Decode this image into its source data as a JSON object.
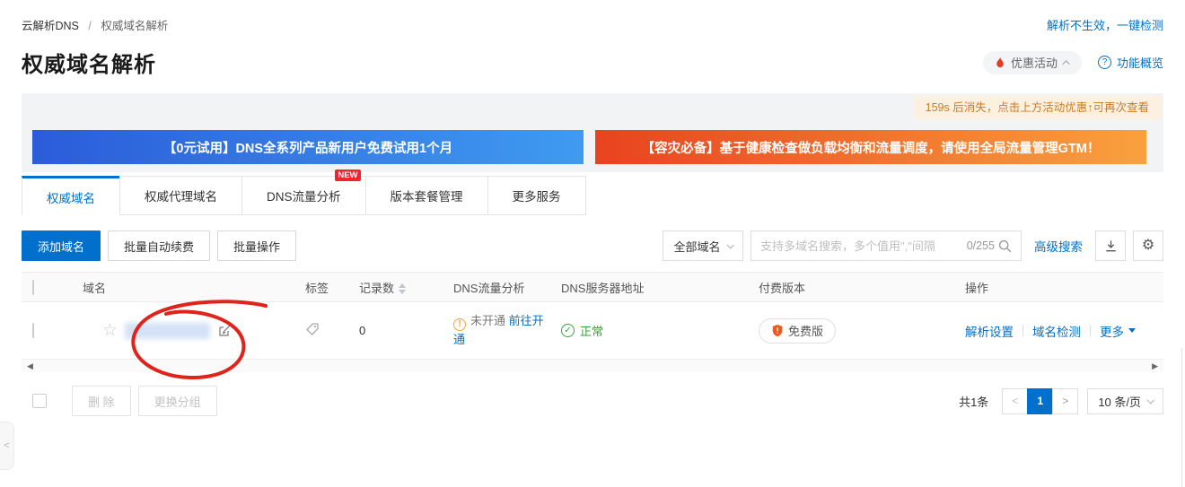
{
  "colors": {
    "primary_blue": "#0070cc",
    "banner_blue_gradient": [
      "#2b5cd9",
      "#3f9bf0"
    ],
    "banner_orange_gradient": [
      "#e8431f",
      "#f9a13e"
    ],
    "success_green": "#36a13c",
    "warning_orange": "#f7a728",
    "new_badge_red": "#f5222d",
    "annotation_red": "#e0231b",
    "tip_bg": "#fcf1e1",
    "tip_text": "#c97b25"
  },
  "breadcrumb": {
    "root": "云解析DNS",
    "separator": "/",
    "current": "权威域名解析"
  },
  "header": {
    "diagnose_link": "解析不生效，一键检测",
    "title": "权威域名解析",
    "promo_button": "优惠活动",
    "overview_link": "功能概览",
    "question_mark": "?"
  },
  "notice": {
    "countdown_tip": "159s 后消失，点击上方活动优惠↑可再次查看",
    "left_banner": "【0元试用】DNS全系列产品新用户免费试用1个月",
    "right_banner": "【容灾必备】基于健康检查做负载均衡和流量调度，请使用全局流量管理GTM！"
  },
  "tabs": [
    {
      "label": "权威域名"
    },
    {
      "label": "权威代理域名"
    },
    {
      "label": "DNS流量分析",
      "badge": "NEW"
    },
    {
      "label": "版本套餐管理"
    },
    {
      "label": "更多服务"
    }
  ],
  "toolbar": {
    "add_domain": "添加域名",
    "batch_renew": "批量自动续费",
    "batch_operation": "批量操作",
    "domain_filter": "全部域名",
    "search_placeholder": "支持多域名搜索，多个值用\",\"间隔",
    "char_counter": "0/255",
    "advanced_search": "高级搜索"
  },
  "table": {
    "headers": [
      "域名",
      "标签",
      "记录数",
      "DNS流量分析",
      "DNS服务器地址",
      "付费版本",
      "操作"
    ],
    "row": {
      "record_count": "0",
      "traffic_status": "未开通",
      "traffic_link": "前往开通",
      "server_status": "正常",
      "warning_mark": "!",
      "check_mark": "✓",
      "plan_badge": "免费版",
      "action_resolve": "解析设置",
      "action_check": "域名检测",
      "action_more": "更多"
    }
  },
  "footer": {
    "delete_button": "删 除",
    "change_group_button": "更换分组",
    "total_text": "共1条",
    "prev": "<",
    "current_page": "1",
    "next": ">",
    "page_size": "10 条/页"
  },
  "scrollbar": {
    "left_arrow": "◀",
    "right_arrow": "▶",
    "collapse_chevron": "<"
  }
}
